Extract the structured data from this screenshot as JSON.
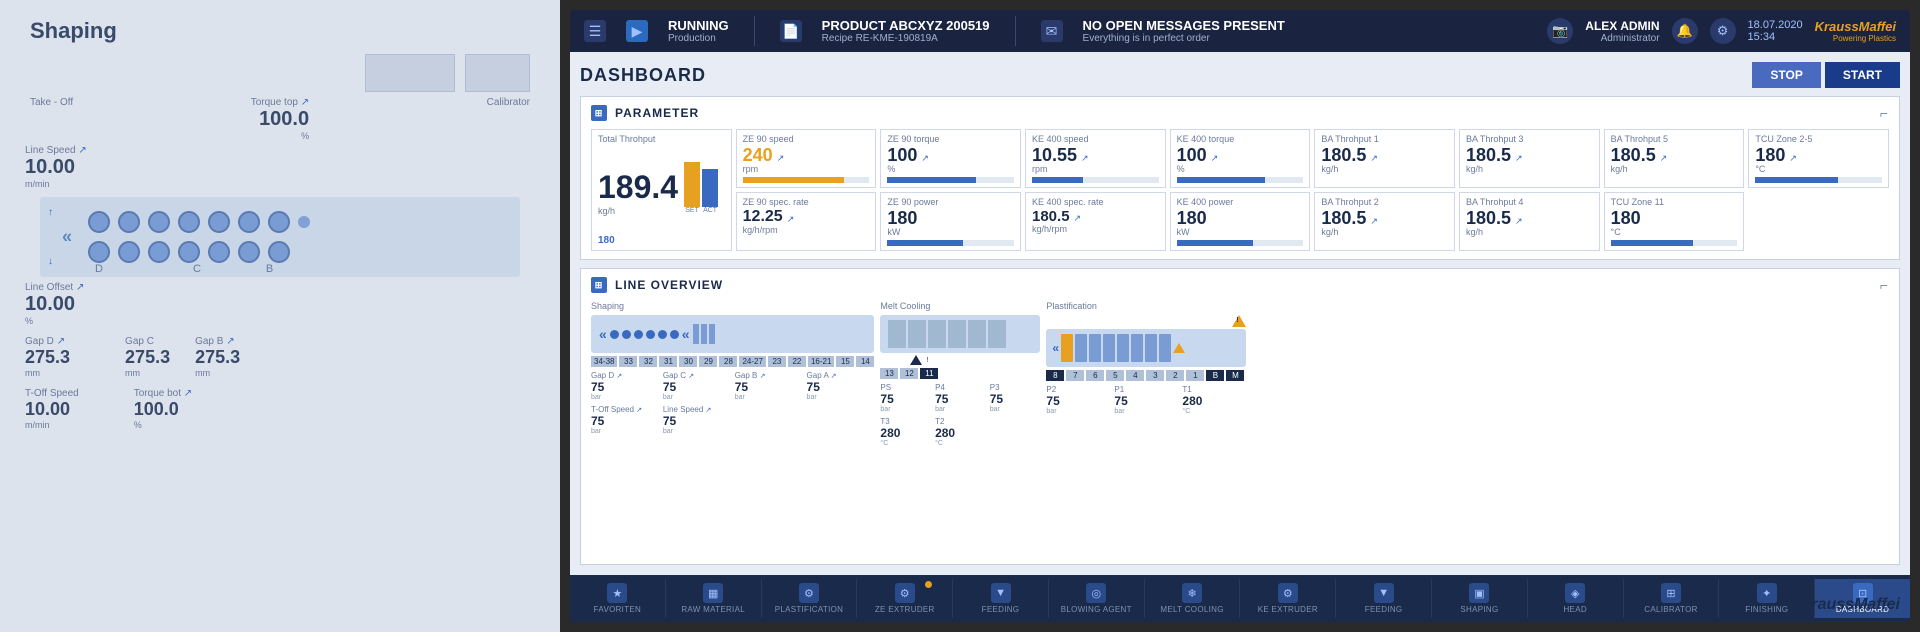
{
  "left_panel": {
    "title": "Shaping",
    "take_off_label": "Take - Off",
    "torque_top_label": "Torque top",
    "torque_top_value": "100.0",
    "torque_top_unit": "%",
    "calibrator_label": "Calibrator",
    "line_speed_label": "Line Speed",
    "line_speed_value": "10.00",
    "line_speed_unit": "m/min",
    "line_offset_label": "Line Offset",
    "line_offset_value": "10.00",
    "line_offset_unit": "%",
    "gap_d_label": "Gap D",
    "gap_d_value": "275.3",
    "gap_d_unit": "mm",
    "gap_c_label": "Gap C",
    "gap_c_value": "275.3",
    "gap_c_unit": "mm",
    "gap_b_label": "Gap B",
    "gap_b_value": "275.3",
    "gap_b_unit": "mm",
    "toff_speed_label": "T-Off Speed",
    "toff_speed_value": "10.00",
    "toff_speed_unit": "m/min",
    "torque_bot_label": "Torque bot",
    "torque_bot_value": "100.0",
    "torque_bot_unit": "%",
    "letters": [
      "D",
      "C",
      "B"
    ]
  },
  "topbar": {
    "status": "RUNNING",
    "status_sub": "Production",
    "product_label": "PRODUCT ABCXYZ 200519",
    "recipe_label": "Recipe RE-KME-190819A",
    "messages_label": "NO OPEN MESSAGES PRESENT",
    "messages_sub": "Everything is in perfect order",
    "user_name": "ALEX ADMIN",
    "user_role": "Administrator",
    "date": "18.07.2020",
    "time": "15:34",
    "brand": "KraussMaffei",
    "brand_sub": "Powering Plastics"
  },
  "dashboard": {
    "title": "DASHBOARD",
    "btn_stop": "STOP",
    "btn_start": "START"
  },
  "parameter_section": {
    "label": "PARAMETER",
    "total_throhput_label": "Total Throhput",
    "total_value": "189.4",
    "total_unit": "kg/h",
    "bar_label": "180",
    "ze90_speed_label": "ZE 90 speed",
    "ze90_speed_value": "240",
    "ze90_speed_unit": "rpm",
    "ze90_torque_label": "ZE 90 torque",
    "ze90_torque_value": "100",
    "ze90_torque_unit": "%",
    "ze90_spec_rate_label": "ZE 90 spec. rate",
    "ze90_spec_rate_value": "12.25",
    "ze90_spec_rate_unit": "kg/h/rpm",
    "ze90_power_label": "ZE 90 power",
    "ze90_power_value": "180",
    "ze90_power_unit": "kW",
    "ke400_speed_label": "KE 400 speed",
    "ke400_speed_value": "10.55",
    "ke400_speed_unit": "rpm",
    "ke400_torque_label": "KE 400 torque",
    "ke400_torque_value": "100",
    "ke400_torque_unit": "%",
    "ke400_spec_rate_label": "KE 400 spec. rate",
    "ke400_spec_rate_value": "180.5",
    "ke400_spec_rate_unit": "kg/h/rpm",
    "ke400_power_label": "KE 400 power",
    "ke400_power_value": "180",
    "ke400_power_unit": "kW",
    "ba1_label": "BA Throhput 1",
    "ba1_value": "180.5",
    "ba1_unit": "kg/h",
    "ba2_label": "BA Throhput 2",
    "ba2_value": "180.5",
    "ba2_unit": "kg/h",
    "ba3_label": "BA Throhput 3",
    "ba3_value": "180.5",
    "ba3_unit": "kg/h",
    "ba4_label": "BA Throhput 4",
    "ba4_value": "180.5",
    "ba4_unit": "kg/h",
    "ba5_label": "BA Throhput 5",
    "ba5_value": "180.5",
    "ba5_unit": "kg/h",
    "tcu_zone_25_label": "TCU Zone 2-5",
    "tcu_zone_25_value": "180",
    "tcu_zone_25_unit": "°C",
    "tcu_zone_11_label": "TCU Zone 11",
    "tcu_zone_11_value": "180",
    "tcu_zone_11_unit": "°C"
  },
  "line_overview": {
    "label": "LINE OVERVIEW",
    "shaping_label": "Shaping",
    "melt_cooling_label": "Melt Cooling",
    "plastification_label": "Plastification",
    "shaping_params": [
      {
        "label": "Gap D",
        "value": "75",
        "unit": "bar",
        "arrow": true
      },
      {
        "label": "Gap C",
        "value": "75",
        "unit": "bar",
        "arrow": true
      },
      {
        "label": "Gap B",
        "value": "75",
        "unit": "bar",
        "arrow": true
      },
      {
        "label": "Gap A",
        "value": "75",
        "unit": "bar",
        "arrow": true
      },
      {
        "label": "T-Off Speed",
        "value": "75",
        "unit": "bar",
        "arrow": true
      },
      {
        "label": "Line Speed",
        "value": "75",
        "unit": "bar",
        "arrow": true
      }
    ],
    "melt_params": [
      {
        "label": "PS",
        "value": "75",
        "unit": "bar"
      },
      {
        "label": "P4",
        "value": "75",
        "unit": "bar"
      },
      {
        "label": "P3",
        "value": "75",
        "unit": "bar"
      },
      {
        "label": "T3",
        "value": "280",
        "unit": "°C"
      },
      {
        "label": "T2",
        "value": "280",
        "unit": "°C"
      }
    ],
    "plast_params": [
      {
        "label": "P2",
        "value": "75",
        "unit": "bar"
      },
      {
        "label": "P1",
        "value": "75",
        "unit": "bar"
      },
      {
        "label": "T1",
        "value": "280",
        "unit": "°C"
      }
    ],
    "numbers_shaping": [
      "34-38",
      "33",
      "32",
      "31",
      "30",
      "29",
      "28",
      "24-27",
      "23",
      "22",
      "16-21",
      "15",
      "14"
    ],
    "numbers_melt": [
      "13",
      "12",
      "11"
    ],
    "numbers_plast": [
      "8",
      "7",
      "6",
      "5",
      "4",
      "3",
      "2",
      "1",
      "B",
      "M"
    ]
  },
  "bottom_nav": [
    {
      "label": "FAVORITEN",
      "icon": "★",
      "active": false
    },
    {
      "label": "RAW MATERIAL",
      "icon": "▦",
      "active": false
    },
    {
      "label": "PLASTIFICATION",
      "icon": "⚙",
      "active": false
    },
    {
      "label": "ZE EXTRUDER",
      "icon": "⚙",
      "active": false,
      "warning": true
    },
    {
      "label": "FEEDING",
      "icon": "▼",
      "active": false
    },
    {
      "label": "BLOWING AGENT",
      "icon": "◎",
      "active": false
    },
    {
      "label": "MELT COOLING",
      "icon": "❄",
      "active": false
    },
    {
      "label": "KE EXTRUDER",
      "icon": "⚙",
      "active": false
    },
    {
      "label": "FEEDING",
      "icon": "▼",
      "active": false
    },
    {
      "label": "SHAPING",
      "icon": "▣",
      "active": false
    },
    {
      "label": "HEAD",
      "icon": "◈",
      "active": false
    },
    {
      "label": "CALIBRATOR",
      "icon": "⊞",
      "active": false
    },
    {
      "label": "FINISHING",
      "icon": "✦",
      "active": false
    },
    {
      "label": "DASHBOARD",
      "icon": "⊡",
      "active": true
    }
  ],
  "km_logo_bottom": "KraussMaffei"
}
